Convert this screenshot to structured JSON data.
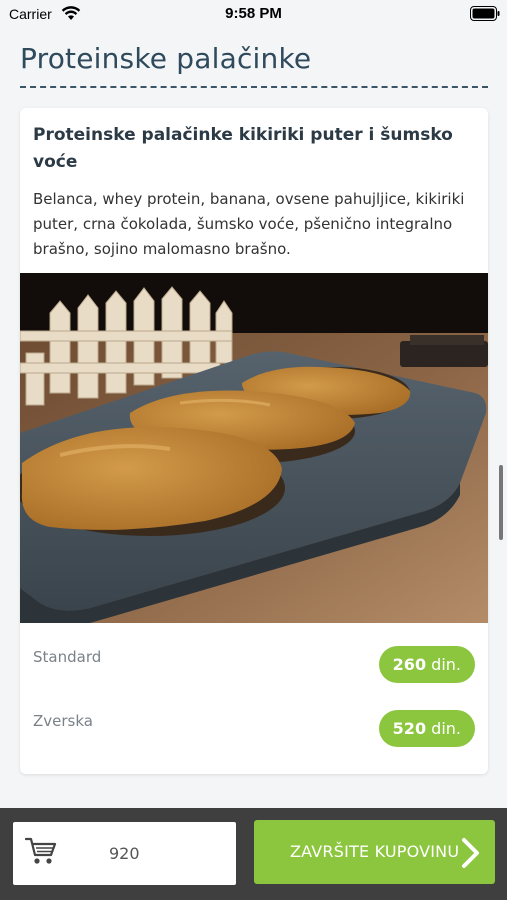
{
  "status_bar": {
    "carrier": "Carrier",
    "time": "9:58 PM"
  },
  "page": {
    "title": "Proteinske palačinke"
  },
  "product": {
    "name": "Proteinske palačinke kikiriki puter i šumsko voće",
    "ingredients": "Belanca, whey protein, banana, ovsene pahujljice, kikiriki puter, crna čokolada, šumsko voće, pšenično integralno brašno, sojino malomasno brašno.",
    "image_icon": "pancakes-photo",
    "options": [
      {
        "label": "Standard",
        "price": "260",
        "currency": "din."
      },
      {
        "label": "Zverska",
        "price": "520",
        "currency": "din."
      }
    ]
  },
  "cart": {
    "icon": "cart-icon",
    "total": "920"
  },
  "checkout": {
    "label": "ZAVRŠITE KUPOVINU",
    "icon": "chevron-right-icon"
  },
  "colors": {
    "accent_green": "#8cc63f",
    "title_color": "#2e4a5c",
    "bottom_bar": "#3f3f3f"
  }
}
